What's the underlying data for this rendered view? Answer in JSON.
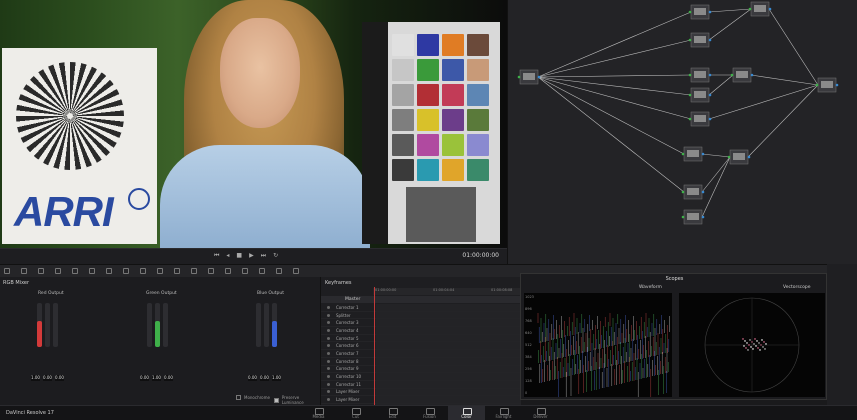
{
  "viewer": {
    "timecode": "01:00:00:00"
  },
  "arri_logo": "ARRI",
  "mixer": {
    "title": "RGB Mixer",
    "outputs": [
      {
        "label": "Red Output",
        "values": [
          "1.00",
          "0.00",
          "0.00"
        ],
        "levels": [
          0.6,
          0.0,
          0.0
        ]
      },
      {
        "label": "Green Output",
        "values": [
          "0.00",
          "1.00",
          "0.00"
        ],
        "levels": [
          0.0,
          0.6,
          0.0
        ]
      },
      {
        "label": "Blue Output",
        "values": [
          "0.00",
          "0.00",
          "1.00"
        ],
        "levels": [
          0.0,
          0.0,
          0.6
        ]
      }
    ],
    "monochrome_label": "Monochrome",
    "preserve_luminance_label": "Preserve Luminance"
  },
  "keyframes": {
    "title": "Keyframes",
    "ruler": [
      "01:00:00:00",
      "01:00:04:04",
      "01:00:08:08"
    ],
    "master": "Master",
    "rows": [
      "Corrector 1",
      "Splitter",
      "Corrector 3",
      "Corrector 4",
      "Corrector 5",
      "Corrector 6",
      "Corrector 7",
      "Corrector 8",
      "Corrector 9",
      "Corrector 10",
      "Corrector 11",
      "Layer Mixer",
      "Layer Mixer",
      "Layer Mixer"
    ]
  },
  "scopes": {
    "title": "Scopes",
    "left_mode": "Waveform",
    "right_mode": "Vectorscope",
    "scale": [
      "1023",
      "896",
      "768",
      "640",
      "512",
      "384",
      "256",
      "128",
      "0"
    ]
  },
  "bottom": {
    "app_name": "DaVinci Resolve 17",
    "pages": [
      "Media",
      "Cut",
      "Edit",
      "Fusion",
      "Color",
      "Fairlight",
      "Deliver"
    ],
    "active_page": "Color"
  },
  "colors": {
    "accent": "#c23a3a",
    "red": "#d33a3a",
    "green": "#3fb04a",
    "blue": "#3a5fd3"
  },
  "checker_colors": [
    "#e0e0e0",
    "#2e39a3",
    "#e07c24",
    "#6b4a3a",
    "#c6c6c6",
    "#3a9a3a",
    "#3d58a8",
    "#c89a78",
    "#a4a4a4",
    "#b22f35",
    "#c23b57",
    "#5d86b4",
    "#7e7e7e",
    "#d8c12a",
    "#6c3d8a",
    "#5a7a3a",
    "#5a5a5a",
    "#b04aa0",
    "#9ac23a",
    "#8a8ad0",
    "#3a3a3a",
    "#2a9ab0",
    "#e0a52a",
    "#3a8a6a"
  ]
}
